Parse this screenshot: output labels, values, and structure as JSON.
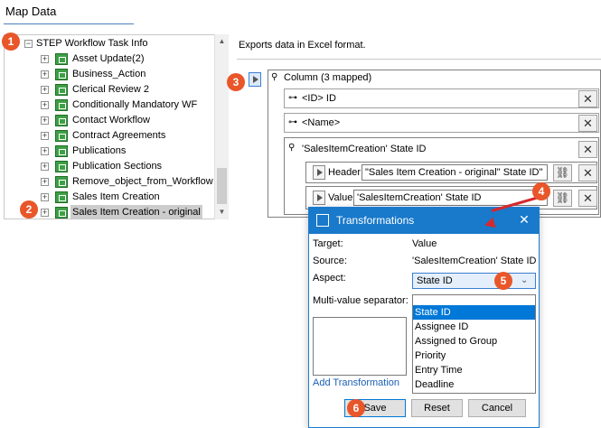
{
  "header": {
    "title": "Map Data"
  },
  "tree": {
    "root_label": "STEP Workflow Task Info",
    "items": [
      {
        "label": "Asset Update(2)"
      },
      {
        "label": "Business_Action"
      },
      {
        "label": "Clerical Review 2"
      },
      {
        "label": "Conditionally Mandatory WF"
      },
      {
        "label": "Contact Workflow"
      },
      {
        "label": "Contract Agreements"
      },
      {
        "label": "Publications"
      },
      {
        "label": "Publication Sections"
      },
      {
        "label": "Remove_object_from_Workflow"
      },
      {
        "label": "Sales Item Creation"
      },
      {
        "label": "Sales Item Creation - original"
      }
    ]
  },
  "right": {
    "description": "Exports data in Excel format.",
    "column_header": "Column (3 mapped)",
    "fields": [
      {
        "label": "<ID> ID"
      },
      {
        "label": "<Name>"
      },
      {
        "label": "'SalesItemCreation' State ID"
      }
    ],
    "header_label": "Header",
    "header_value": "\"Sales Item Creation - original\" State ID\"",
    "value_label": "Value",
    "value_value": "'SalesItemCreation' State ID"
  },
  "dialog": {
    "title": "Transformations",
    "target_label": "Target:",
    "target_value": "Value",
    "source_label": "Source:",
    "source_value": "'SalesItemCreation' State ID",
    "aspect_label": "Aspect:",
    "aspect_value": "State ID",
    "separator_label": "Multi-value separator:",
    "options": [
      "State ID",
      "Assignee ID",
      "Assigned to Group",
      "Priority",
      "Entry Time",
      "Deadline"
    ],
    "add_link": "Add Transformation",
    "save": "Save",
    "reset": "Reset",
    "cancel": "Cancel"
  },
  "markers": [
    "1",
    "2",
    "3",
    "4",
    "5",
    "6"
  ],
  "colors": {
    "accent": "#1979ca",
    "marker": "#e8562a",
    "arrow": "#d6282d",
    "tree_icon": "#3ea046"
  }
}
